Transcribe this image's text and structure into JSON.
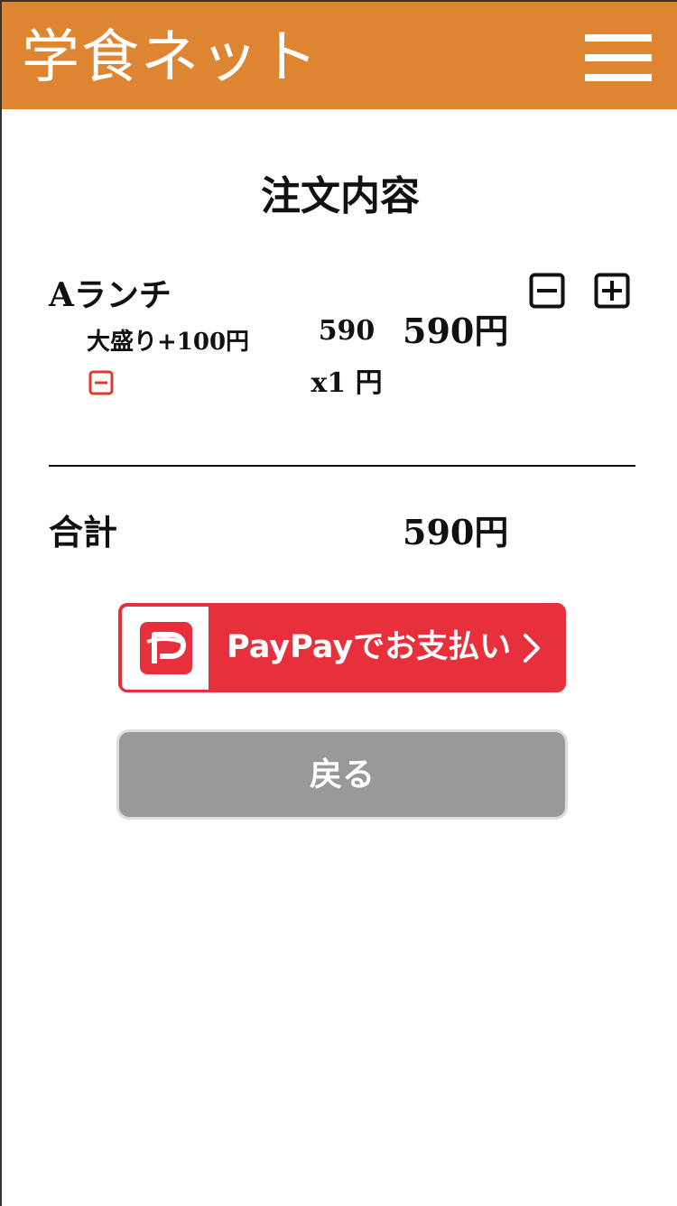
{
  "app": {
    "title": "学食ネット",
    "header_color": "#de8532"
  },
  "header": {
    "menu_icon": "hamburger-menu-icon"
  },
  "page": {
    "title": "注文内容"
  },
  "order": {
    "items": [
      {
        "name": "Aランチ",
        "option": "大盛り+100円",
        "option_remove_icon": "minus-box-icon",
        "unit_price": "590 x1 円",
        "line_total": "590円",
        "decrease_icon": "minus-box-icon",
        "increase_icon": "plus-box-icon"
      }
    ],
    "total_label": "合計",
    "total_value": "590円"
  },
  "actions": {
    "paypay_label": "PayPayでお支払い",
    "paypay_color": "#e8303c",
    "back_label": "戻る",
    "back_color": "#999999"
  }
}
